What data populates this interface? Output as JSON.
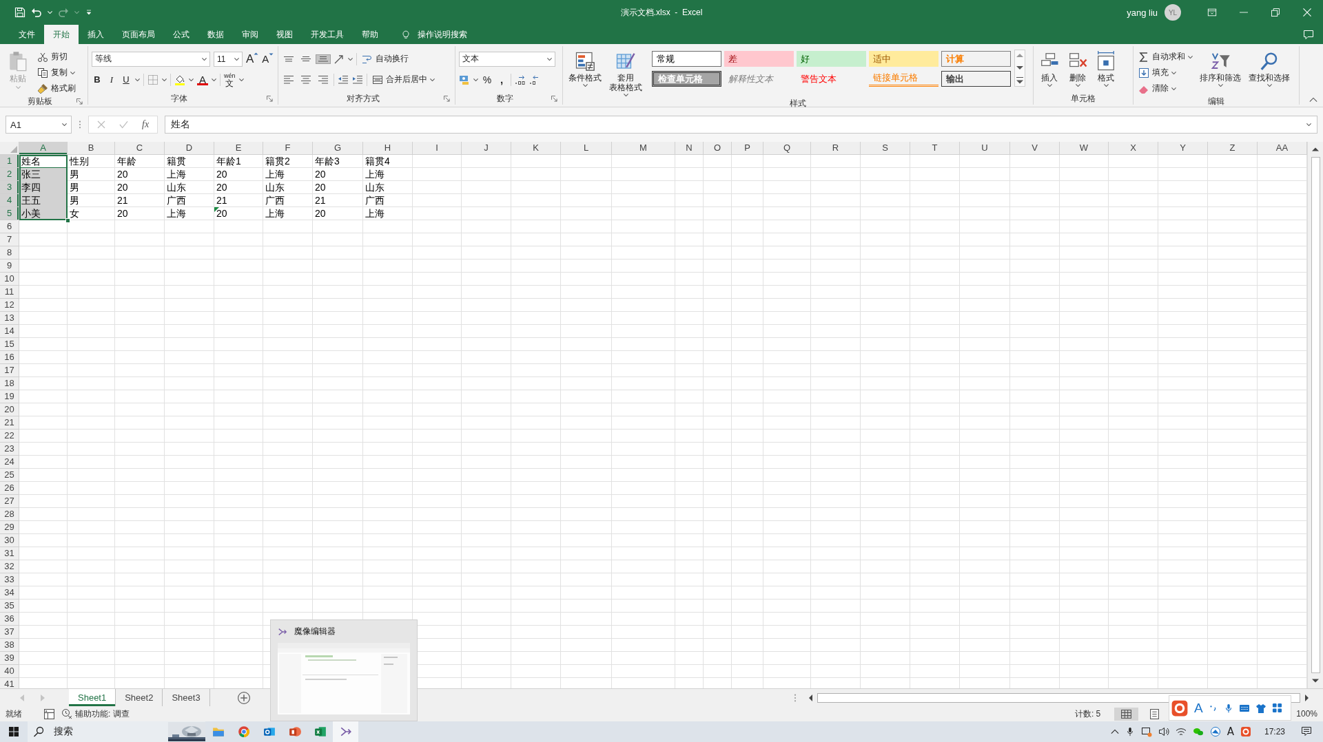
{
  "window": {
    "title": "演示文档.xlsx  -  Excel",
    "user": "yang liu",
    "avatar": "YL"
  },
  "tabs": [
    {
      "label": "文件",
      "selected": false
    },
    {
      "label": "开始",
      "selected": true
    },
    {
      "label": "插入",
      "selected": false
    },
    {
      "label": "页面布局",
      "selected": false
    },
    {
      "label": "公式",
      "selected": false
    },
    {
      "label": "数据",
      "selected": false
    },
    {
      "label": "审阅",
      "selected": false
    },
    {
      "label": "视图",
      "selected": false
    },
    {
      "label": "开发工具",
      "selected": false
    },
    {
      "label": "帮助",
      "selected": false
    }
  ],
  "tell_me": {
    "label": "操作说明搜索"
  },
  "clipboard": {
    "paste": "粘贴",
    "cut": "剪切",
    "copy": "复制",
    "format_painter": "格式刷",
    "label": "剪贴板"
  },
  "font": {
    "name": "等线",
    "size": "11",
    "grow": "A",
    "shrink": "A",
    "bold": "B",
    "italic": "I",
    "underline": "U",
    "font_color": "A",
    "phonetic_top": "wén",
    "phonetic_bottom": "文",
    "label": "字体"
  },
  "alignment": {
    "vertical": [
      {
        "kind": "top",
        "selected": false
      },
      {
        "kind": "middle",
        "selected": false
      },
      {
        "kind": "bottom",
        "selected": true
      }
    ],
    "wrap_text": "自动换行",
    "merge_center": "合并后居中",
    "label": "对齐方式"
  },
  "number": {
    "format": "文本",
    "percent": "%",
    "comma": ",",
    "label": "数字"
  },
  "styles": {
    "conditional": "条件格式",
    "table_format": [
      "套用",
      "表格格式"
    ],
    "label": "样式",
    "cells": [
      {
        "label": "常规",
        "kind": "normal"
      },
      {
        "label": "差",
        "kind": "bad"
      },
      {
        "label": "好",
        "kind": "good"
      },
      {
        "label": "适中",
        "kind": "neutral"
      },
      {
        "label": "计算",
        "kind": "calculation"
      },
      {
        "label": "检查单元格",
        "kind": "check"
      },
      {
        "label": "解释性文本",
        "kind": "explanatory"
      },
      {
        "label": "警告文本",
        "kind": "warning"
      },
      {
        "label": "链接单元格",
        "kind": "linked"
      },
      {
        "label": "输出",
        "kind": "output"
      }
    ]
  },
  "cells_group": {
    "insert": "插入",
    "delete": "删除",
    "format": "格式",
    "label": "单元格"
  },
  "editing": {
    "autosum": "自动求和",
    "fill": "填充",
    "clear": "清除",
    "sort_filter": "排序和筛选",
    "find_select": "查找和选择",
    "label": "编辑"
  },
  "formula_bar": {
    "name_box": "A1",
    "function_label": "fx",
    "value": "姓名"
  },
  "grid": {
    "columns": [
      {
        "label": "A",
        "selected": true
      },
      {
        "label": "B",
        "selected": false
      },
      {
        "label": "C",
        "selected": false
      },
      {
        "label": "D",
        "selected": false
      },
      {
        "label": "E",
        "selected": false
      },
      {
        "label": "F",
        "selected": false
      },
      {
        "label": "G",
        "selected": false
      },
      {
        "label": "H",
        "selected": false
      },
      {
        "label": "I",
        "selected": false
      },
      {
        "label": "J",
        "selected": false
      },
      {
        "label": "K",
        "selected": false
      },
      {
        "label": "L",
        "selected": false
      },
      {
        "label": "M",
        "selected": false
      },
      {
        "label": "N",
        "selected": false
      },
      {
        "label": "O",
        "selected": false
      },
      {
        "label": "P",
        "selected": false
      },
      {
        "label": "Q",
        "selected": false
      },
      {
        "label": "R",
        "selected": false
      },
      {
        "label": "S",
        "selected": false
      },
      {
        "label": "T",
        "selected": false
      },
      {
        "label": "U",
        "selected": false
      },
      {
        "label": "V",
        "selected": false
      },
      {
        "label": "W",
        "selected": false
      },
      {
        "label": "X",
        "selected": false
      },
      {
        "label": "Y",
        "selected": false
      },
      {
        "label": "Z",
        "selected": false
      },
      {
        "label": "AA",
        "selected": false
      }
    ],
    "rows": [
      {
        "number": "1",
        "selected": true,
        "cells": [
          {
            "text": "姓名",
            "selected": true,
            "active": true,
            "flagged": false
          },
          {
            "text": "性别",
            "selected": false,
            "active": false,
            "flagged": false
          },
          {
            "text": "年龄",
            "selected": false,
            "active": false,
            "flagged": false
          },
          {
            "text": "籍贯",
            "selected": false,
            "active": false,
            "flagged": false
          },
          {
            "text": "年龄1",
            "selected": false,
            "active": false,
            "flagged": false
          },
          {
            "text": "籍贯2",
            "selected": false,
            "active": false,
            "flagged": false
          },
          {
            "text": "年龄3",
            "selected": false,
            "active": false,
            "flagged": false
          },
          {
            "text": "籍贯4",
            "selected": false,
            "active": false,
            "flagged": false
          }
        ]
      },
      {
        "number": "2",
        "selected": true,
        "cells": [
          {
            "text": "张三",
            "selected": true,
            "active": false,
            "flagged": false
          },
          {
            "text": "男",
            "selected": false,
            "active": false,
            "flagged": false
          },
          {
            "text": "20",
            "selected": false,
            "active": false,
            "flagged": false
          },
          {
            "text": "上海",
            "selected": false,
            "active": false,
            "flagged": false
          },
          {
            "text": "20",
            "selected": false,
            "active": false,
            "flagged": false
          },
          {
            "text": "上海",
            "selected": false,
            "active": false,
            "flagged": false
          },
          {
            "text": "20",
            "selected": false,
            "active": false,
            "flagged": false
          },
          {
            "text": "上海",
            "selected": false,
            "active": false,
            "flagged": false
          }
        ]
      },
      {
        "number": "3",
        "selected": true,
        "cells": [
          {
            "text": "李四",
            "selected": true,
            "active": false,
            "flagged": false
          },
          {
            "text": "男",
            "selected": false,
            "active": false,
            "flagged": false
          },
          {
            "text": "20",
            "selected": false,
            "active": false,
            "flagged": false
          },
          {
            "text": "山东",
            "selected": false,
            "active": false,
            "flagged": false
          },
          {
            "text": "20",
            "selected": false,
            "active": false,
            "flagged": false
          },
          {
            "text": "山东",
            "selected": false,
            "active": false,
            "flagged": false
          },
          {
            "text": "20",
            "selected": false,
            "active": false,
            "flagged": false
          },
          {
            "text": "山东",
            "selected": false,
            "active": false,
            "flagged": false
          }
        ]
      },
      {
        "number": "4",
        "selected": true,
        "cells": [
          {
            "text": "王五",
            "selected": true,
            "active": false,
            "flagged": false
          },
          {
            "text": "男",
            "selected": false,
            "active": false,
            "flagged": false
          },
          {
            "text": "21",
            "selected": false,
            "active": false,
            "flagged": false
          },
          {
            "text": "广西",
            "selected": false,
            "active": false,
            "flagged": false
          },
          {
            "text": "21",
            "selected": false,
            "active": false,
            "flagged": false
          },
          {
            "text": "广西",
            "selected": false,
            "active": false,
            "flagged": false
          },
          {
            "text": "21",
            "selected": false,
            "active": false,
            "flagged": false
          },
          {
            "text": "广西",
            "selected": false,
            "active": false,
            "flagged": false
          }
        ]
      },
      {
        "number": "5",
        "selected": true,
        "cells": [
          {
            "text": "小美",
            "selected": true,
            "active": false,
            "flagged": false
          },
          {
            "text": "女",
            "selected": false,
            "active": false,
            "flagged": false
          },
          {
            "text": "20",
            "selected": false,
            "active": false,
            "flagged": false
          },
          {
            "text": "上海",
            "selected": false,
            "active": false,
            "flagged": false
          },
          {
            "text": "20",
            "selected": false,
            "active": false,
            "flagged": true
          },
          {
            "text": "上海",
            "selected": false,
            "active": false,
            "flagged": false
          },
          {
            "text": "20",
            "selected": false,
            "active": false,
            "flagged": false
          },
          {
            "text": "上海",
            "selected": false,
            "active": false,
            "flagged": false
          }
        ]
      },
      {
        "number": "6",
        "selected": false
      },
      {
        "number": "7",
        "selected": false
      },
      {
        "number": "8",
        "selected": false
      },
      {
        "number": "9",
        "selected": false
      },
      {
        "number": "10",
        "selected": false
      },
      {
        "number": "11",
        "selected": false
      },
      {
        "number": "12",
        "selected": false
      },
      {
        "number": "13",
        "selected": false
      },
      {
        "number": "14",
        "selected": false
      },
      {
        "number": "15",
        "selected": false
      },
      {
        "number": "16",
        "selected": false
      },
      {
        "number": "17",
        "selected": false
      },
      {
        "number": "18",
        "selected": false
      },
      {
        "number": "19",
        "selected": false
      },
      {
        "number": "20",
        "selected": false
      },
      {
        "number": "21",
        "selected": false
      },
      {
        "number": "22",
        "selected": false
      },
      {
        "number": "23",
        "selected": false
      },
      {
        "number": "24",
        "selected": false
      },
      {
        "number": "25",
        "selected": false
      },
      {
        "number": "26",
        "selected": false
      },
      {
        "number": "27",
        "selected": false
      },
      {
        "number": "28",
        "selected": false
      },
      {
        "number": "29",
        "selected": false
      },
      {
        "number": "30",
        "selected": false
      },
      {
        "number": "31",
        "selected": false
      },
      {
        "number": "32",
        "selected": false
      },
      {
        "number": "33",
        "selected": false
      },
      {
        "number": "34",
        "selected": false
      },
      {
        "number": "35",
        "selected": false
      },
      {
        "number": "36",
        "selected": false
      },
      {
        "number": "37",
        "selected": false
      },
      {
        "number": "38",
        "selected": false
      },
      {
        "number": "39",
        "selected": false
      },
      {
        "number": "40",
        "selected": false
      },
      {
        "number": "41",
        "selected": false
      }
    ]
  },
  "sheets": [
    {
      "label": "Sheet1",
      "selected": true
    },
    {
      "label": "Sheet2",
      "selected": false
    },
    {
      "label": "Sheet3",
      "selected": false
    }
  ],
  "status_bar": {
    "ready": "就绪",
    "accessibility": "辅助功能: 调查",
    "count": "计数: 5",
    "zoom": "100%",
    "views": [
      {
        "kind": "normal",
        "selected": true
      },
      {
        "kind": "page_layout",
        "selected": false
      }
    ]
  },
  "taskbar": {
    "search": "搜索",
    "apps": [
      {
        "kind": "explorer",
        "selected": false
      },
      {
        "kind": "chrome",
        "selected": false
      },
      {
        "kind": "outlook",
        "selected": false
      },
      {
        "kind": "powerpoint",
        "selected": false
      },
      {
        "kind": "excel",
        "selected": false
      },
      {
        "kind": "golem",
        "selected": true
      }
    ],
    "font_tray": "A",
    "clock": "17:23"
  },
  "taskbar_preview": {
    "title": "魔像编辑器"
  },
  "ime_toolbar": {
    "mode": "A"
  }
}
